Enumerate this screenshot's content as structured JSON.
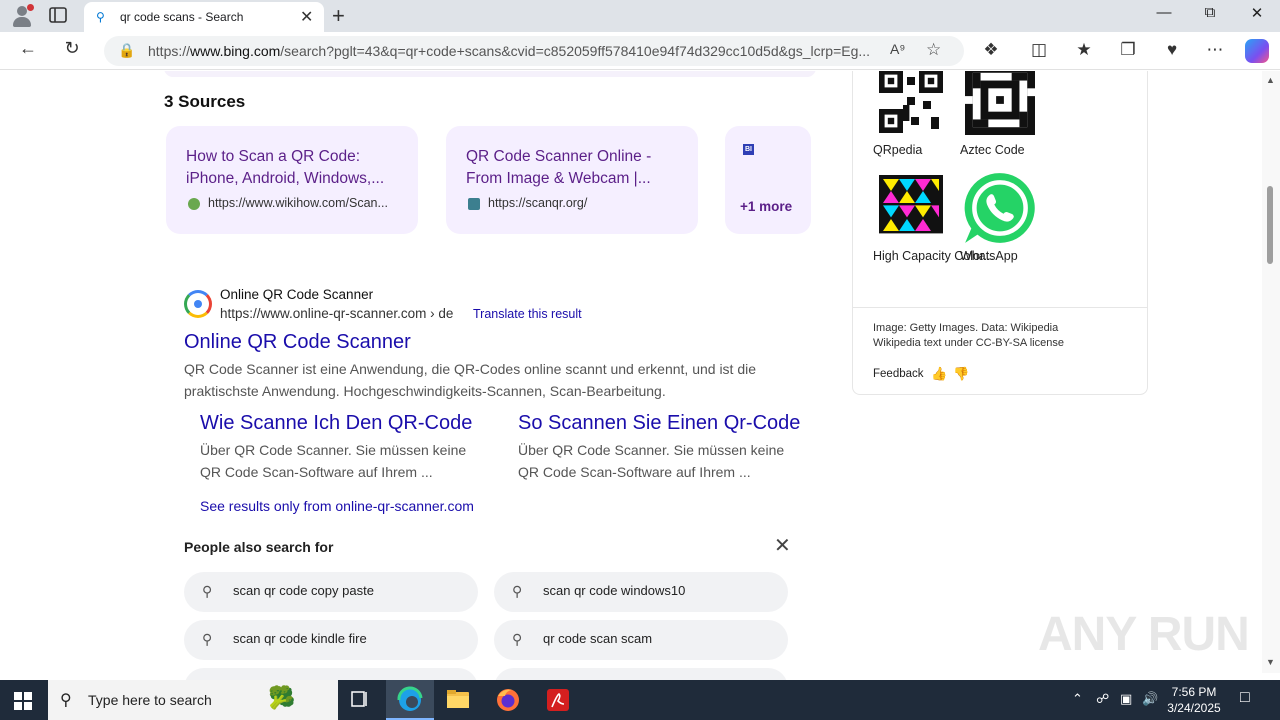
{
  "browser": {
    "tab_title": "qr code scans - Search",
    "url_prefix": "https://",
    "url_domain": "www.bing.com",
    "url_rest": "/search?pglt=43&q=qr+code+scans&cvid=c852059ff578410e94f74d329cc10d5d&gs_lcrp=Eg..."
  },
  "sources": {
    "heading": "3 Sources",
    "cards": [
      {
        "title": "How to Scan a QR Code: iPhone, Android, Windows,...",
        "url": "https://www.wikihow.com/Scan..."
      },
      {
        "title": "QR Code Scanner Online - From Image & Webcam |...",
        "url": "https://scanqr.org/"
      }
    ],
    "more_badge": "BI",
    "more_label": "+1 more"
  },
  "result": {
    "site_name": "Online QR Code Scanner",
    "site_url": "https://www.online-qr-scanner.com › de",
    "translate": "Translate this result",
    "title": "Online QR Code Scanner",
    "snippet": "QR Code Scanner ist eine Anwendung, die QR-Codes online scannt und erkennt, und ist die praktischste Anwendung. Hochgeschwindigkeits-Scannen, Scan-Bearbeitung.",
    "deeplinks": [
      {
        "title": "Wie Scanne Ich Den QR-Code",
        "snippet": "Über QR Code Scanner. Sie müssen keine QR Code Scan-Software auf Ihrem ..."
      },
      {
        "title": "So Scannen Sie Einen Qr-Code",
        "snippet": "Über QR Code Scanner. Sie müssen keine QR Code Scan-Software auf Ihrem ..."
      }
    ],
    "see_only": "See results only from online-qr-scanner.com"
  },
  "people_also": {
    "heading": "People also search for",
    "items": [
      "scan qr code copy paste",
      "scan qr code windows10",
      "scan qr code kindle fire",
      "qr code scan scam"
    ]
  },
  "right_panel": {
    "images": [
      {
        "label": "QRpedia"
      },
      {
        "label": "Aztec Code"
      },
      {
        "label": "High Capacity Color..."
      },
      {
        "label": "WhatsApp"
      }
    ],
    "credit_line1": "Image: Getty Images. Data: Wikipedia",
    "credit_line2": "Wikipedia text under CC-BY-SA license",
    "feedback": "Feedback"
  },
  "watermark": "ANY RUN",
  "taskbar": {
    "search_placeholder": "Type here to search",
    "time": "7:56 PM",
    "date": "3/24/2025"
  },
  "colors": {
    "link": "#1a0dab",
    "source_title": "#5b1f88",
    "card_bg": "#f5efff",
    "taskbar_bg": "#1f2b3a"
  }
}
